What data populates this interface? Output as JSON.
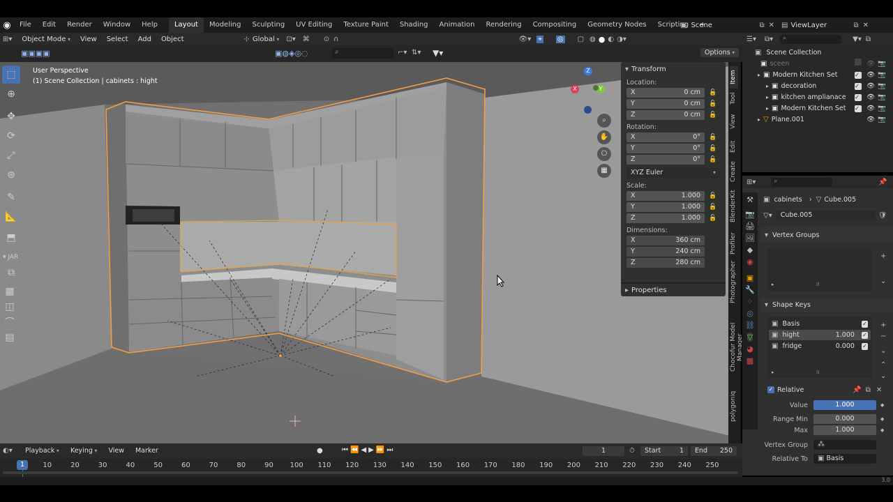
{
  "menubar": {
    "items": [
      "File",
      "Edit",
      "Render",
      "Window",
      "Help"
    ]
  },
  "workspaces": [
    "Layout",
    "Modeling",
    "Sculpting",
    "UV Editing",
    "Texture Paint",
    "Shading",
    "Animation",
    "Rendering",
    "Compositing",
    "Geometry Nodes",
    "Scripting",
    "+"
  ],
  "scene": {
    "label": "Scene",
    "view_layer": "ViewLayer"
  },
  "viewport_header": {
    "mode": "Object Mode",
    "menus": [
      "View",
      "Select",
      "Add",
      "Object"
    ],
    "orientation": "Global",
    "options": "Options"
  },
  "overlay_text": {
    "perspective": "User Perspective",
    "collection": "(1) Scene Collection | cabinets : hight"
  },
  "left_tools": {
    "jar": "JAR"
  },
  "npanel": {
    "title": "Transform",
    "location_label": "Location:",
    "location": [
      [
        "X",
        "0 cm"
      ],
      [
        "Y",
        "0 cm"
      ],
      [
        "Z",
        "0 cm"
      ]
    ],
    "rotation_label": "Rotation:",
    "rotation": [
      [
        "X",
        "0°"
      ],
      [
        "Y",
        "0°"
      ],
      [
        "Z",
        "0°"
      ]
    ],
    "rotation_mode": "XYZ Euler",
    "scale_label": "Scale:",
    "scale": [
      [
        "X",
        "1.000"
      ],
      [
        "Y",
        "1.000"
      ],
      [
        "Z",
        "1.000"
      ]
    ],
    "dimensions_label": "Dimensions:",
    "dimensions": [
      [
        "X",
        "360 cm"
      ],
      [
        "Y",
        "240 cm"
      ],
      [
        "Z",
        "280 cm"
      ]
    ],
    "properties": "Properties"
  },
  "side_tabs": [
    "Item",
    "Tool",
    "View",
    "Edit",
    "Create",
    "BlenderKit",
    "Profiler",
    "Photographer",
    "Chocofur Model Manager",
    "polygoniq"
  ],
  "outliner": {
    "root": "Scene Collection",
    "items": [
      {
        "label": "sceen",
        "indent": 1,
        "dim": true
      },
      {
        "label": "Modern Kitchen Set",
        "indent": 1
      },
      {
        "label": "decoration",
        "indent": 2
      },
      {
        "label": "kitchen amplianace",
        "indent": 2
      },
      {
        "label": "Modern Kitchen Set",
        "indent": 2
      },
      {
        "label": "Plane.001",
        "indent": 1
      }
    ]
  },
  "properties": {
    "breadcrumb_obj": "cabinets",
    "breadcrumb_data": "Cube.005",
    "mesh_name": "Cube.005",
    "vertex_groups": "Vertex Groups",
    "shape_keys": "Shape Keys",
    "keys": [
      {
        "name": "Basis",
        "value": ""
      },
      {
        "name": "hight",
        "value": "1.000"
      },
      {
        "name": "fridge",
        "value": "0.000"
      }
    ],
    "relative": "Relative",
    "value_label": "Value",
    "value": "1.000",
    "range_min_label": "Range Min",
    "range_min": "0.000",
    "max_label": "Max",
    "max": "1.000",
    "vertex_group_label": "Vertex Group",
    "relative_to_label": "Relative To",
    "relative_to": "Basis"
  },
  "timeline": {
    "menus": [
      "Playback",
      "Keying",
      "View",
      "Marker"
    ],
    "current_frame": "1",
    "start_label": "Start",
    "start": "1",
    "end_label": "End",
    "end": "250",
    "ticks": [
      "1",
      "10",
      "20",
      "30",
      "40",
      "50",
      "60",
      "70",
      "80",
      "90",
      "100",
      "110",
      "120",
      "130",
      "140",
      "150",
      "160",
      "170",
      "180",
      "190",
      "200",
      "210",
      "220",
      "230",
      "240",
      "250"
    ]
  },
  "version": "3.0"
}
